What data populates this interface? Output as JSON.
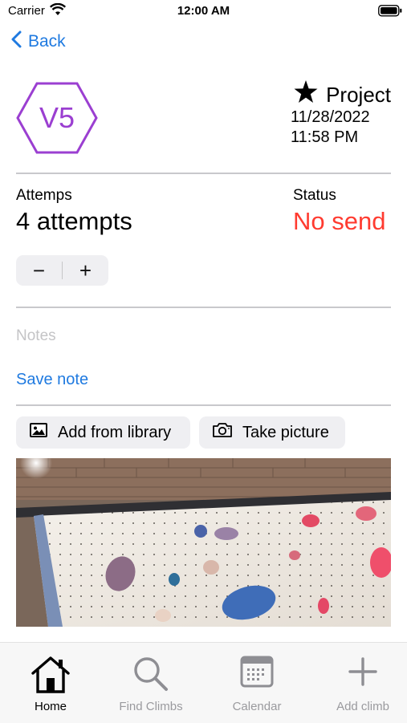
{
  "status_bar": {
    "carrier": "Carrier",
    "time": "12:00 AM"
  },
  "nav": {
    "back_label": "Back"
  },
  "climb": {
    "grade": "V5",
    "type_label": "Project",
    "date": "11/28/2022",
    "time": "11:58 PM"
  },
  "attempts": {
    "label": "Attemps",
    "value": "4 attempts"
  },
  "status": {
    "label": "Status",
    "value": "No send"
  },
  "stepper": {
    "minus": "−",
    "plus": "+"
  },
  "notes": {
    "placeholder": "Notes",
    "save_label": "Save note"
  },
  "photo_actions": {
    "library_label": "Add from library",
    "camera_label": "Take picture"
  },
  "tabbar": {
    "items": [
      {
        "label": "Home",
        "icon": "house-icon",
        "active": true
      },
      {
        "label": "Find Climbs",
        "icon": "magnifier-icon",
        "active": false
      },
      {
        "label": "Calendar",
        "icon": "calendar-icon",
        "active": false
      },
      {
        "label": "Add climb",
        "icon": "plus-icon",
        "active": false
      }
    ]
  },
  "colors": {
    "accent": "#1f7ae0",
    "grade": "#9b3fd1",
    "no_send": "#ff3b30"
  }
}
